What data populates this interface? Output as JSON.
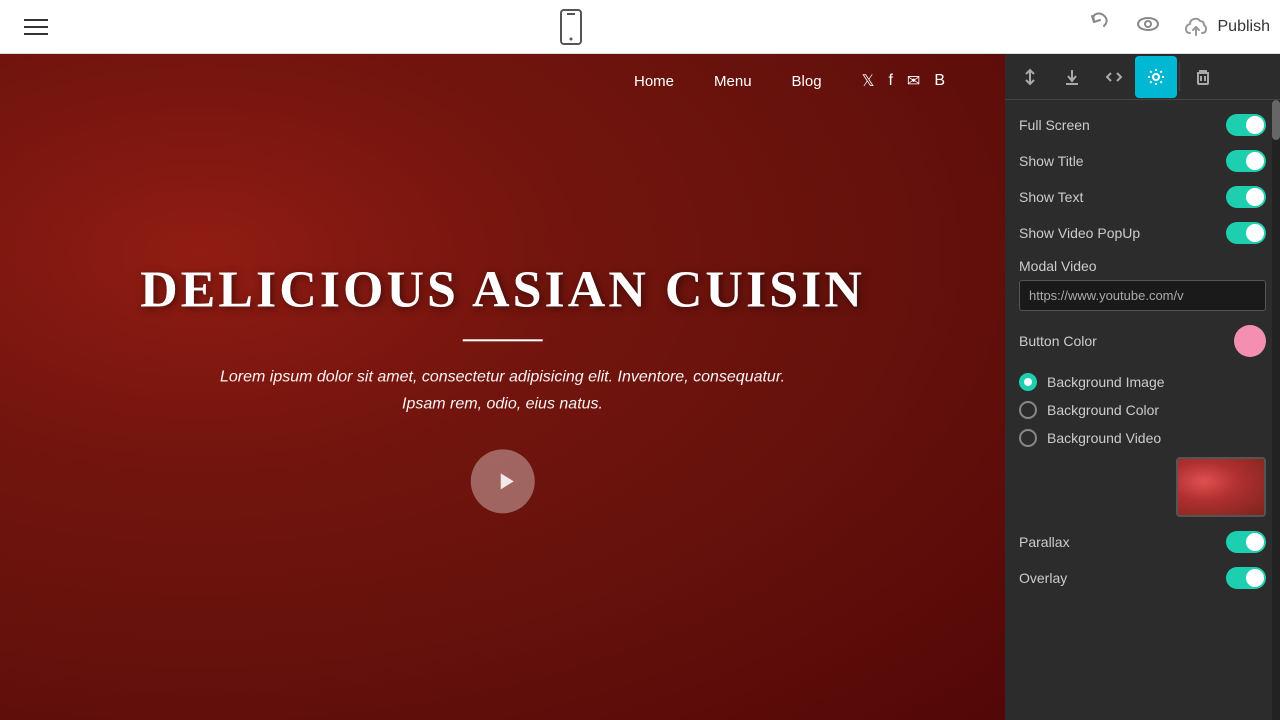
{
  "topbar": {
    "publish_label": "Publish"
  },
  "canvas_nav": {
    "links": [
      "Home",
      "Menu",
      "Blog"
    ],
    "social_icons": [
      "twitter",
      "facebook",
      "email",
      "book"
    ]
  },
  "hero": {
    "title": "DELICIOUS ASIAN CUISIN",
    "subtitle": "Lorem ipsum dolor sit amet, consectetur adipisicing elit. Inventore, consequatur. Ipsam rem, odio, eius natus."
  },
  "panel": {
    "toolbar_buttons": [
      {
        "id": "sort",
        "label": "↕",
        "active": false
      },
      {
        "id": "download",
        "label": "↓",
        "active": false
      },
      {
        "id": "code",
        "label": "</>",
        "active": false
      },
      {
        "id": "settings",
        "label": "⚙",
        "active": true
      },
      {
        "id": "trash",
        "label": "🗑",
        "active": false
      }
    ],
    "settings": {
      "full_screen_label": "Full Screen",
      "full_screen_on": true,
      "show_title_label": "Show Title",
      "show_title_on": true,
      "show_text_label": "Show Text",
      "show_text_on": true,
      "show_video_popup_label": "Show Video PopUp",
      "show_video_popup_on": true,
      "modal_video_label": "Modal Video",
      "modal_video_placeholder": "https://www.youtube.com/v",
      "modal_video_value": "https://www.youtube.com/v",
      "button_color_label": "Button Color",
      "button_color_hex": "#f48fb1",
      "bg_image_label": "Background Image",
      "bg_image_selected": true,
      "bg_color_label": "Background Color",
      "bg_color_selected": false,
      "bg_video_label": "Background Video",
      "bg_video_selected": false,
      "parallax_label": "Parallax",
      "parallax_on": true,
      "overlay_label": "Overlay",
      "overlay_on": true
    }
  }
}
